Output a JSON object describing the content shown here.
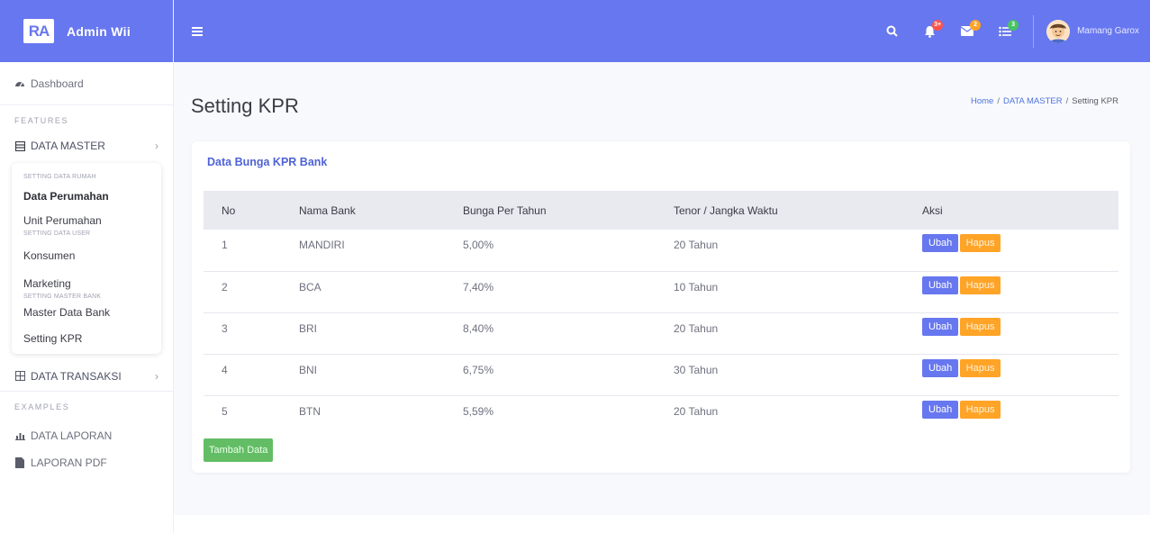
{
  "brand": {
    "logo": "RA",
    "name": "Admin Wii"
  },
  "sidebar": {
    "dashboard": "Dashboard",
    "heading_features": "FEATURES",
    "data_master": "DATA MASTER",
    "submenu": {
      "heading_rumah": "SETTING DATA RUMAH",
      "data_perumahan": "Data Perumahan",
      "unit_perumahan": "Unit Perumahan",
      "heading_user": "SETTING DATA USER",
      "konsumen": "Konsumen",
      "marketing": "Marketing",
      "heading_bank": "SETTING MASTER BANK",
      "master_data_bank": "Master Data Bank",
      "setting_kpr": "Setting KPR"
    },
    "data_transaksi": "DATA TRANSAKSI",
    "heading_examples": "EXAMPLES",
    "data_laporan": "DATA LAPORAN",
    "laporan_pdf": "LAPORAN PDF"
  },
  "topbar": {
    "notif_badge": "3+",
    "messages_badge": "2",
    "tasks_badge": "3",
    "user_name": "Mamang Garox"
  },
  "page": {
    "title": "Setting KPR",
    "breadcrumb": [
      "Home",
      "DATA MASTER",
      "Setting KPR"
    ]
  },
  "card": {
    "title": "Data Bunga KPR Bank",
    "columns": [
      "No",
      "Nama Bank",
      "Bunga Per Tahun",
      "Tenor / Jangka Waktu",
      "Aksi"
    ],
    "rows": [
      {
        "no": "1",
        "bank": "MANDIRI",
        "bunga": "5,00%",
        "tenor": "20 Tahun"
      },
      {
        "no": "2",
        "bank": "BCA",
        "bunga": "7,40%",
        "tenor": "10 Tahun"
      },
      {
        "no": "3",
        "bank": "BRI",
        "bunga": "8,40%",
        "tenor": "20 Tahun"
      },
      {
        "no": "4",
        "bank": "BNI",
        "bunga": "6,75%",
        "tenor": "30 Tahun"
      },
      {
        "no": "5",
        "bank": "BTN",
        "bunga": "5,59%",
        "tenor": "20 Tahun"
      }
    ],
    "edit_label": "Ubah",
    "delete_label": "Hapus",
    "add_label": "Tambah Data"
  },
  "colors": {
    "primary": "#6777ef",
    "warning": "#ffa426",
    "success": "#63bd65",
    "badge_notif": "#fc544b",
    "badge_msg": "#ffa426",
    "badge_task": "#47c363"
  },
  "icons": {
    "menu": "hamburger-icon",
    "search": "search-icon",
    "notifications": "bell-icon",
    "messages": "envelope-icon",
    "tasks": "tasks-icon",
    "dashboard": "tachometer-icon",
    "data_master": "archive-icon",
    "data_transaksi": "table-icon",
    "data_laporan": "chart-icon",
    "laporan_pdf": "file-pdf-icon"
  }
}
